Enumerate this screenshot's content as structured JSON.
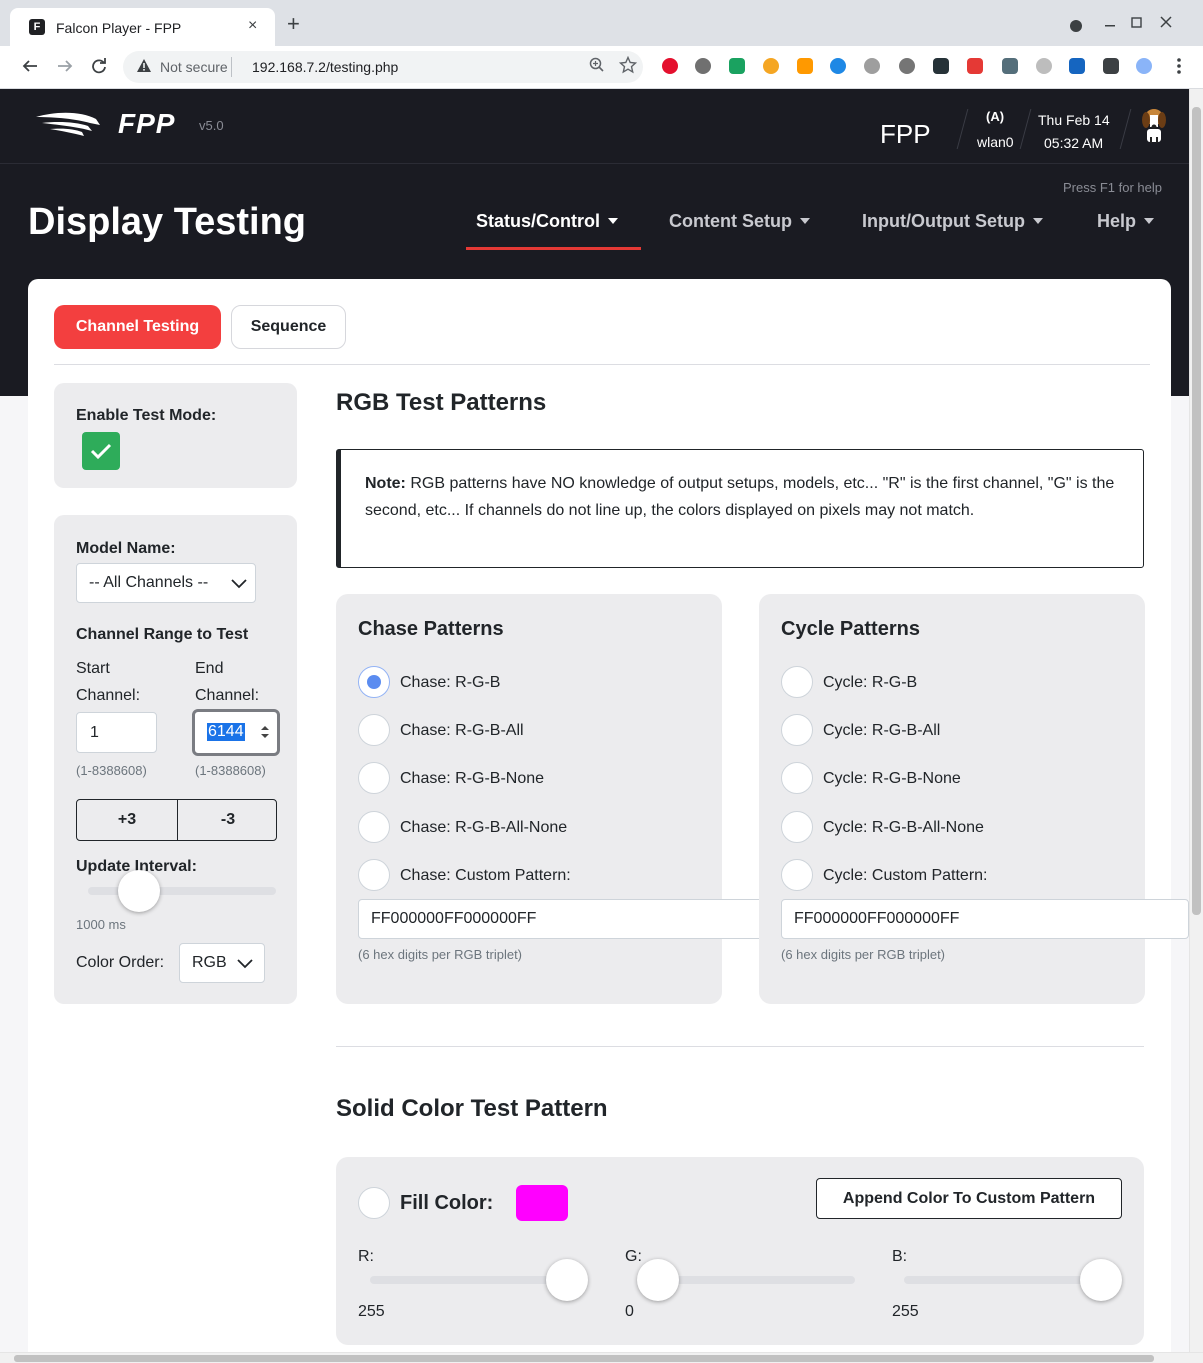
{
  "browser": {
    "tab_title": "Falcon Player - FPP",
    "tab_favicon": "F",
    "tab_close_glyph": "×",
    "new_tab_glyph": "+",
    "not_secure": "Not secure",
    "url": "192.168.7.2/testing.php"
  },
  "header": {
    "logo_text": "FPP",
    "version": "v5.0",
    "host": "FPP",
    "wifi_symbol": "(A)",
    "interface": "wlan0",
    "date": "Thu Feb 14",
    "time": "05:32 AM"
  },
  "titlebar": {
    "help_hint": "Press F1 for help",
    "page_title": "Display Testing",
    "nav": [
      {
        "label": "Status/Control",
        "active": true
      },
      {
        "label": "Content Setup",
        "active": false
      },
      {
        "label": "Input/Output Setup",
        "active": false
      },
      {
        "label": "Help",
        "active": false
      }
    ]
  },
  "tabs": {
    "channel_testing": "Channel Testing",
    "sequence": "Sequence"
  },
  "sidebar": {
    "enable_label": "Enable Test Mode:",
    "enable_checked": true,
    "model_label": "Model Name:",
    "model_value": "-- All Channels --",
    "range_label": "Channel Range to Test",
    "start_label_1": "Start",
    "start_label_2": "Channel:",
    "end_label_1": "End",
    "end_label_2": "Channel:",
    "start_value": "1",
    "end_value": "6144",
    "start_range": "(1-8388608)",
    "end_range": "(1-8388608)",
    "plus_label": "+3",
    "minus_label": "-3",
    "interval_label": "Update Interval:",
    "interval_value": "1000 ms",
    "interval_fraction": 0.25,
    "color_order_label": "Color Order:",
    "color_order_value": "RGB"
  },
  "main": {
    "rgb_title": "RGB Test Patterns",
    "note_bold": "Note:",
    "note_text": " RGB patterns have NO knowledge of output setups, models, etc... \"R\" is the first channel, \"G\" is the second, etc... If channels do not line up, the colors displayed on pixels may not match.",
    "chase": {
      "title": "Chase Patterns",
      "options": [
        "Chase: R-G-B",
        "Chase: R-G-B-All",
        "Chase: R-G-B-None",
        "Chase: R-G-B-All-None",
        "Chase: Custom Pattern:"
      ],
      "selected": 0,
      "custom_value": "FF000000FF000000FF",
      "hint": "(6 hex digits per RGB triplet)"
    },
    "cycle": {
      "title": "Cycle Patterns",
      "options": [
        "Cycle: R-G-B",
        "Cycle: R-G-B-All",
        "Cycle: R-G-B-None",
        "Cycle: R-G-B-All-None",
        "Cycle: Custom Pattern:"
      ],
      "selected": -1,
      "custom_value": "FF000000FF000000FF",
      "hint": "(6 hex digits per RGB triplet)"
    },
    "solid_title": "Solid Color Test Pattern",
    "fill_label": "Fill Color:",
    "fill_color": "#ff00ff",
    "append_label": "Append Color To Custom Pattern",
    "r_label": "R:",
    "g_label": "G:",
    "b_label": "B:",
    "r_value": "255",
    "g_value": "0",
    "b_value": "255"
  },
  "colors": {
    "accent_red": "#f33f3f",
    "checkbox_green": "#2eac5a",
    "radio_blue": "#5b8cf0",
    "dark_bg": "#1a1b22"
  }
}
